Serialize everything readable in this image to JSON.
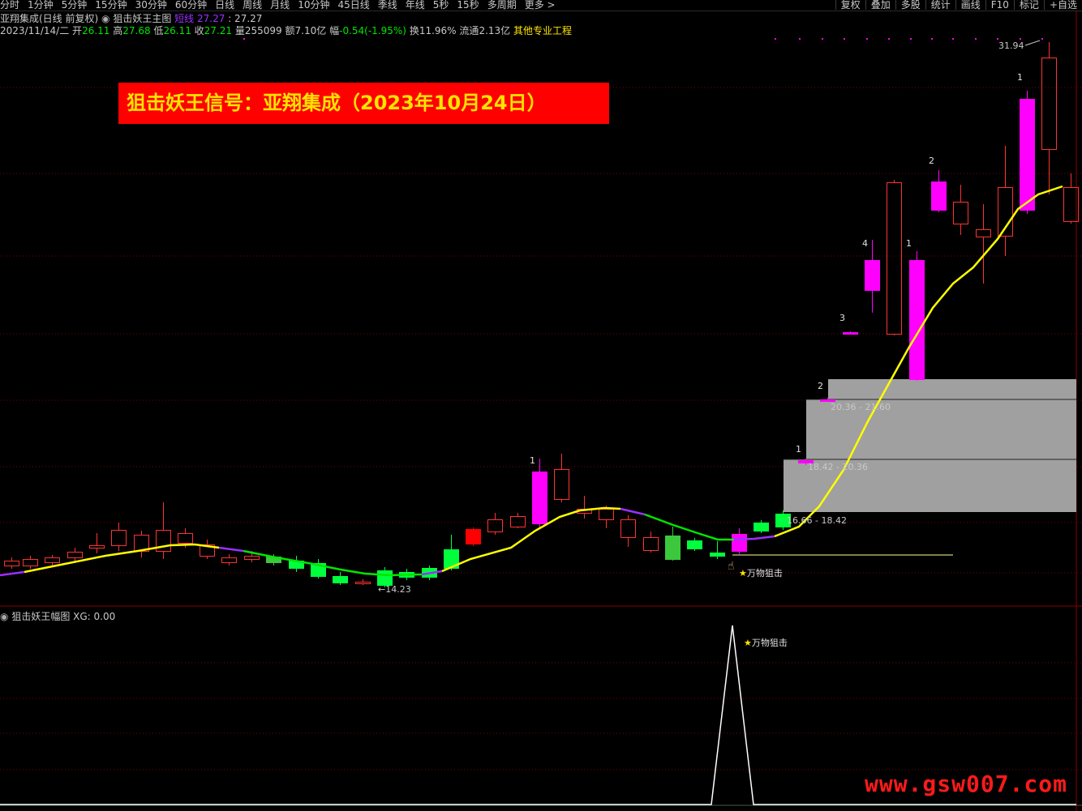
{
  "toolbar": {
    "periods": [
      "分时",
      "1分钟",
      "5分钟",
      "15分钟",
      "30分钟",
      "60分钟",
      "日线",
      "周线",
      "月线",
      "10分钟",
      "45日线",
      "季线",
      "年线",
      "5秒",
      "15秒",
      "多周期",
      "更多 >"
    ],
    "active_period": "日线",
    "right_buttons": [
      "复权",
      "叠加",
      "多股",
      "统计",
      "画线",
      "F10",
      "标记",
      "+自选"
    ]
  },
  "header": {
    "stock_title": "亚翔集成(日线 前复权)",
    "indicator_name": "狙击妖王主图",
    "line_label": "短线",
    "line_value": "27.27",
    "line_value2": ": 27.27"
  },
  "quote": {
    "date": "2023/11/14/二",
    "open_label": "开",
    "open": "26.11",
    "high_label": "高",
    "high": "27.68",
    "low_label": "低",
    "low": "26.11",
    "close_label": "收",
    "close": "27.21",
    "vol_label": "量",
    "vol": "255099",
    "amt_label": "额",
    "amt": "7.10亿",
    "chg_label": "幅",
    "chg": "-0.54(-1.95%)",
    "turnover_label": "换",
    "turnover": "11.96%",
    "float_label": "流通",
    "float": "2.13亿",
    "other": "其他专业工程"
  },
  "banner": {
    "text": "狙击妖王信号：亚翔集成（2023年10月24日）"
  },
  "annotations": {
    "high_price": "31.94",
    "low_price": "14.23",
    "signal_text": "万物狙击",
    "box1_range": "16.66 - 18.42",
    "box2_range": "18.42 - 20.36",
    "box3_range": "20.36 - 21.60",
    "counts": [
      "1",
      "1",
      "2",
      "3",
      "4",
      "1",
      "2",
      "1"
    ]
  },
  "sub_chart": {
    "title": "狙击妖王幅图",
    "xg_label": "XG:",
    "xg_value": "0.00",
    "signal_text": "万物狙击"
  },
  "watermark": "www.gsw007.com",
  "colors": {
    "up": "#ff3232",
    "down": "#00e600",
    "magenta": "#ff00ff",
    "yellow": "#ffff00",
    "purple": "#9b30ff",
    "gray_box": "#a0a0a0"
  }
}
